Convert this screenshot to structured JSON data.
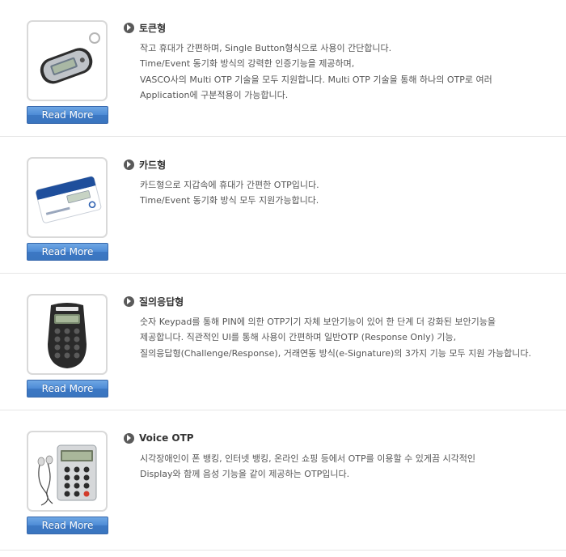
{
  "products": [
    {
      "title": "토큰형",
      "image_icon": "otp-token-keyfob-icon",
      "read_more_label": "Read More",
      "lines": [
        "작고 휴대가 간편하며, Single Button형식으로 사용이 간단합니다.",
        "Time/Event 동기화 방식의 강력한 인증기능을 제공하며,",
        "VASCO사의 Multi OTP 기술을 모두 지원합니다. Multi OTP 기술을 통해 하나의 OTP로 여러",
        "Application에 구분적용이 가능합니다."
      ]
    },
    {
      "title": "카드형",
      "image_icon": "otp-card-icon",
      "read_more_label": "Read More",
      "lines": [
        "카드형으로 지갑속에 휴대가 간편한 OTP입니다.",
        "Time/Event 동기화 방식 모두 지원가능합니다."
      ]
    },
    {
      "title": "질의응답형",
      "image_icon": "otp-keypad-device-icon",
      "read_more_label": "Read More",
      "lines": [
        "숫자 Keypad를 통해 PIN에 의한 OTP기기 자체 보안기능이 있어 한 단계 더 강화된 보안기능을",
        "제공합니다. 직관적인 UI를 통해 사용이 간편하며 일반OTP (Response Only) 기능,",
        "질의응답형(Challenge/Response), 거래연동 방식(e-Signature)의 3가지 기능 모두 지원 가능합니다."
      ]
    },
    {
      "title": "Voice OTP",
      "image_icon": "voice-otp-device-earphones-icon",
      "read_more_label": "Read More",
      "lines": [
        "시각장애인이 폰 뱅킹, 인터넷 뱅킹, 온라인 쇼핑 등에서 OTP를 이용할 수 있게끔 시각적인",
        "Display와 함께 음성 기능을 같이 제공하는 OTP입니다."
      ]
    }
  ],
  "colors": {
    "button_top": "#6fa7e4",
    "button_bottom": "#3a75bf",
    "bullet": "#5a5a5a",
    "divider": "#e6e6e6"
  }
}
